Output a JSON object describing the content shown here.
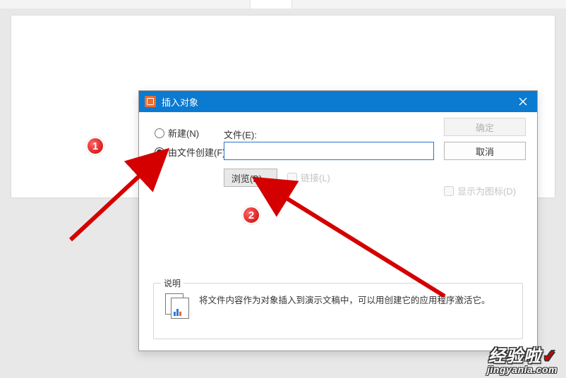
{
  "dialog": {
    "title": "插入对象",
    "radio_new": "新建(N)",
    "radio_from_file": "由文件创建(F)",
    "file_label": "文件(E):",
    "file_value": "",
    "browse_label": "浏览(B)...",
    "link_label": "链接(L)",
    "show_icon_label": "显示为图标(D)",
    "ok_label": "确定",
    "cancel_label": "取消",
    "description_heading": "说明",
    "description_text": "将文件内容作为对象插入到演示文稿中，可以用创建它的应用程序激活它。"
  },
  "annotations": {
    "marker1": "1",
    "marker2": "2"
  },
  "watermark": {
    "brand": "经验啦",
    "check": "✓",
    "url": "jingyanla.com"
  }
}
